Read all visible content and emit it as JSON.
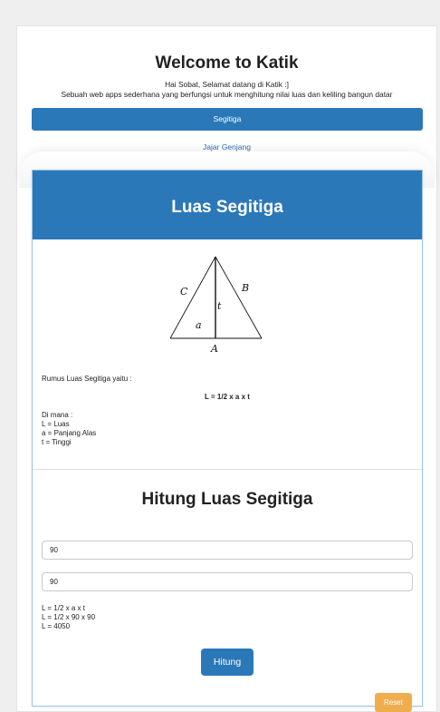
{
  "header": {
    "title": "Welcome to Katik",
    "subtitle_line1": "Hai Sobat, Selamat datang di Katik :]",
    "subtitle_line2": "Sebuah web apps sederhana yang berfungsi untuk menghitung nilai luas dan keliling bangun datar"
  },
  "nav": {
    "active_label": "Segitiga",
    "link_label": "Jajar Genjang"
  },
  "card": {
    "header_title": "Luas Segitiga",
    "diagram": {
      "label_c": "C",
      "label_b": "B",
      "label_t": "t",
      "label_a": "a",
      "label_A": "A"
    },
    "formula_intro": "Rumus Luas Segitiga yaitu :",
    "formula": "L = 1/2 x a x t",
    "legend": {
      "heading": "Di mana :",
      "l": "L = Luas",
      "a": "a = Panjang Alas",
      "t": "t = Tinggi"
    },
    "calc_title": "Hitung Luas Segitiga",
    "input_alas_value": "90",
    "input_tinggi_value": "90",
    "results": {
      "line1": "L = 1/2 x a x t",
      "line2": "L = 1/2 x 90 x 90",
      "line3": "L = 4050"
    },
    "hitung_label": "Hitung",
    "reset_label": "Reset"
  },
  "colors": {
    "primary": "#2b78b9",
    "warning": "#f0ad4e",
    "link": "#2b6fb0"
  }
}
